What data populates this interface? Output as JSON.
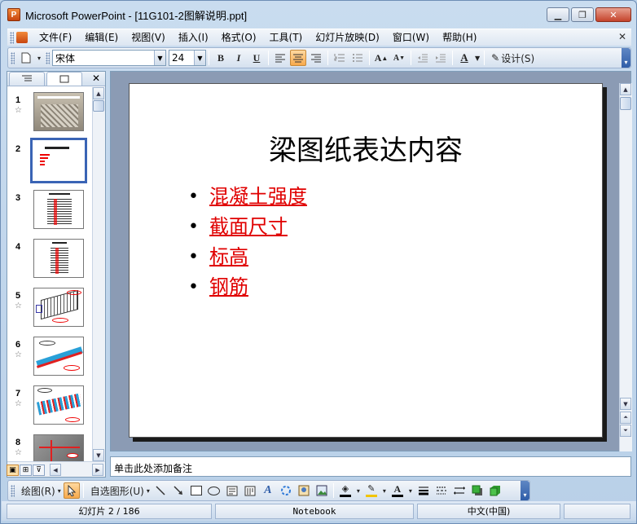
{
  "window": {
    "title": "Microsoft PowerPoint - [11G101-2图解说明.ppt]"
  },
  "menu": [
    "文件(F)",
    "编辑(E)",
    "视图(V)",
    "插入(I)",
    "格式(O)",
    "工具(T)",
    "幻灯片放映(D)",
    "窗口(W)",
    "帮助(H)"
  ],
  "toolbar": {
    "font_name": "宋体",
    "font_size": "24",
    "bold": "B",
    "italic": "I",
    "underline": "U",
    "design_label": "设计(S)"
  },
  "slides_pane": {
    "thumbnails": [
      {
        "num": "1",
        "star": "☆"
      },
      {
        "num": "2",
        "star": ""
      },
      {
        "num": "3",
        "star": ""
      },
      {
        "num": "4",
        "star": ""
      },
      {
        "num": "5",
        "star": "☆"
      },
      {
        "num": "6",
        "star": "☆"
      },
      {
        "num": "7",
        "star": "☆"
      },
      {
        "num": "8",
        "star": "☆"
      }
    ]
  },
  "slide": {
    "title": "梁图纸表达内容",
    "bullets": [
      "混凝土强度",
      "截面尺寸",
      "标高",
      "钢筋"
    ]
  },
  "notes": {
    "placeholder": "单击此处添加备注"
  },
  "drawing_toolbar": {
    "draw_label": "绘图(R)",
    "autoshape_label": "自选图形(U)"
  },
  "statusbar": {
    "slide_info": "幻灯片 2 / 186",
    "template": "Notebook",
    "language": "中文(中国)"
  },
  "colors": {
    "accent_selected": "#3a64b5",
    "bullet_text": "#e00000",
    "slide_bg": "#ffffff"
  }
}
